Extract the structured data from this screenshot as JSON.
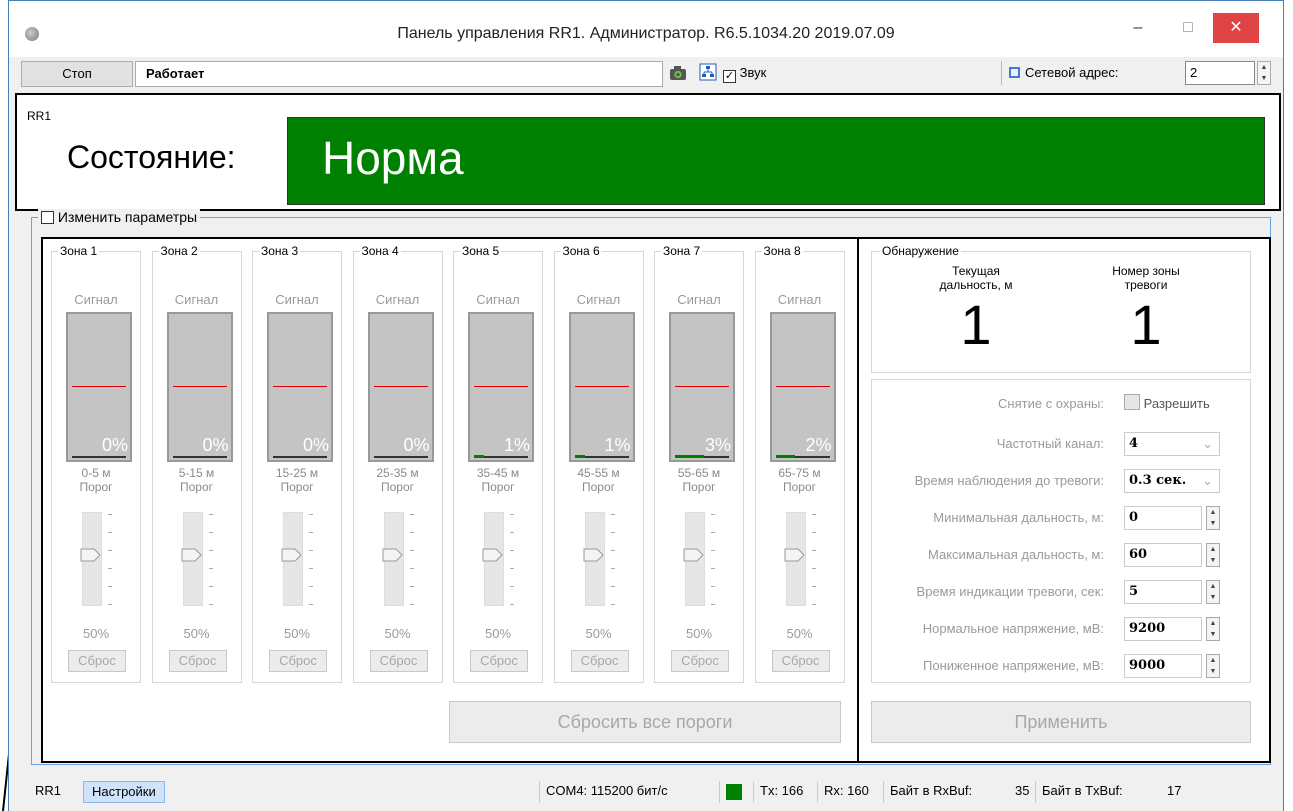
{
  "window": {
    "title": "Панель управления RR1. Администратор. R6.5.1034.20 2019.07.09",
    "minimize": "–",
    "maximize": "□",
    "close": "✕"
  },
  "toolbar": {
    "stop_label": "Стоп",
    "status_value": "Работает",
    "camera_icon": "camera-icon",
    "sound_label": "Звук",
    "sound_checked": true,
    "network_label": "Сетевой адрес:",
    "network_value": "2"
  },
  "rr1": {
    "group_title": "RR1",
    "state_label": "Состояние:",
    "state_value": "Норма",
    "state_color": "#008000"
  },
  "params": {
    "change_label": "Изменить параметры"
  },
  "zones": [
    {
      "title": "Зона 1",
      "signal_label": "Сигнал",
      "signal_pct": "0%",
      "fill": 0,
      "range": "0-5 м",
      "threshold_label": "Порог",
      "threshold_pct": "50%",
      "reset_label": "Сброс"
    },
    {
      "title": "Зона 2",
      "signal_label": "Сигнал",
      "signal_pct": "0%",
      "fill": 0,
      "range": "5-15 м",
      "threshold_label": "Порог",
      "threshold_pct": "50%",
      "reset_label": "Сброс"
    },
    {
      "title": "Зона 3",
      "signal_label": "Сигнал",
      "signal_pct": "0%",
      "fill": 0,
      "range": "15-25 м",
      "threshold_label": "Порог",
      "threshold_pct": "50%",
      "reset_label": "Сброс"
    },
    {
      "title": "Зона 4",
      "signal_label": "Сигнал",
      "signal_pct": "0%",
      "fill": 0,
      "range": "25-35 м",
      "threshold_label": "Порог",
      "threshold_pct": "50%",
      "reset_label": "Сброс"
    },
    {
      "title": "Зона 5",
      "signal_label": "Сигнал",
      "signal_pct": "1%",
      "fill": 0.01,
      "range": "35-45 м",
      "threshold_label": "Порог",
      "threshold_pct": "50%",
      "reset_label": "Сброс"
    },
    {
      "title": "Зона 6",
      "signal_label": "Сигнал",
      "signal_pct": "1%",
      "fill": 0.01,
      "range": "45-55 м",
      "threshold_label": "Порог",
      "threshold_pct": "50%",
      "reset_label": "Сброс"
    },
    {
      "title": "Зона 7",
      "signal_label": "Сигнал",
      "signal_pct": "3%",
      "fill": 0.03,
      "range": "55-65 м",
      "threshold_label": "Порог",
      "threshold_pct": "50%",
      "reset_label": "Сброс"
    },
    {
      "title": "Зона 8",
      "signal_label": "Сигнал",
      "signal_pct": "2%",
      "fill": 0.02,
      "range": "65-75 м",
      "threshold_label": "Порог",
      "threshold_pct": "50%",
      "reset_label": "Сброс"
    }
  ],
  "reset_all_label": "Сбросить все пороги",
  "detection": {
    "group_title": "Обнаружение",
    "distance_caption": "Текущая\nдальность, м",
    "distance_value": "1",
    "zone_caption": "Номер зоны\nтревоги",
    "zone_value": "1",
    "disarm_label": "Снятие с охраны:",
    "allow_label": "Разрешить",
    "fields": [
      {
        "label": "Частотный канал:",
        "value": "4",
        "type": "dropdown"
      },
      {
        "label": "Время наблюдения до тревоги:",
        "value": "0.3 сек.",
        "type": "dropdown"
      },
      {
        "label": "Минимальная дальность, м:",
        "value": "0",
        "type": "spin"
      },
      {
        "label": "Максимальная дальность, м:",
        "value": "60",
        "type": "spin"
      },
      {
        "label": "Время индикации тревоги, сек:",
        "value": "5",
        "type": "spin"
      },
      {
        "label": "Нормальное напряжение, мВ:",
        "value": "9200",
        "type": "spin"
      },
      {
        "label": "Пониженное напряжение, мВ:",
        "value": "9000",
        "type": "spin"
      }
    ],
    "apply_label": "Применить"
  },
  "statusbar": {
    "tab_rr1": "RR1",
    "tab_settings": "Настройки",
    "com": "COM4: 115200 бит/с",
    "link_color": "#008000",
    "tx": "Tx: 166",
    "rx": "Rx: 160",
    "rxbuf_label": "Байт в RxBuf:",
    "rxbuf_value": "35",
    "txbuf_label": "Байт в TxBuf:",
    "txbuf_value": "17"
  }
}
